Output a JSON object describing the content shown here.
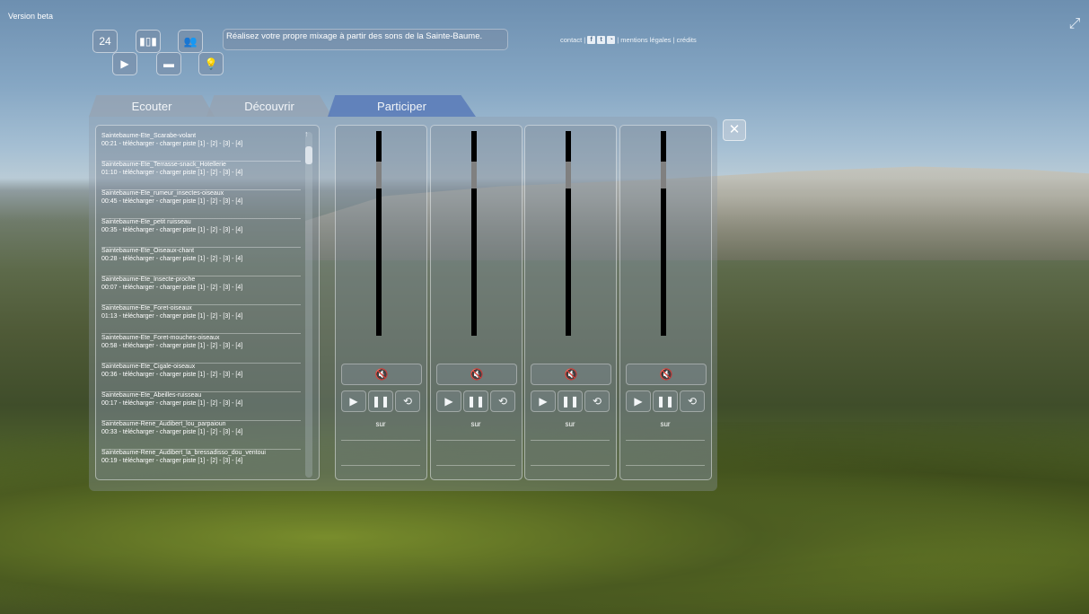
{
  "app": {
    "version_label": "Version beta",
    "banner_text": "Réalisez votre propre mixage à partir des sons de la Sainte-Baume."
  },
  "icons": {
    "calendar": {
      "name": "calendar-icon",
      "glyph": "24"
    },
    "equalizer": {
      "name": "equalizer-icon",
      "glyph": "▮▯▮"
    },
    "users": {
      "name": "users-icon",
      "glyph": "👥"
    },
    "video": {
      "name": "video-icon",
      "glyph": "▶"
    },
    "chat": {
      "name": "chat-icon",
      "glyph": "▬"
    },
    "lightbulb": {
      "name": "lightbulb-icon",
      "glyph": "💡"
    },
    "fullscreen": {
      "name": "fullscreen-icon",
      "glyph": "⤢"
    },
    "close": {
      "name": "close-icon",
      "glyph": "✕"
    },
    "scroll_up": {
      "name": "scroll-up-icon",
      "glyph": "↑"
    }
  },
  "top_links": {
    "contact": "contact |",
    "facebook": "f",
    "twitter": "t",
    "rss": "◔",
    "legal": "| mentions légales | crédits"
  },
  "tabs": [
    {
      "label": "Ecouter",
      "active": false
    },
    {
      "label": "Découvrir",
      "active": false
    },
    {
      "label": "Participer",
      "active": true
    }
  ],
  "sound_list": [
    {
      "title": "Saintebaume-Ete_Scarabe-volant",
      "line": "00:21 - télécharger - charger piste [1] - [2] - [3] - [4]"
    },
    {
      "title": "Saintebaume-Ete_Terrasse-snack_Hotellerie",
      "line": "01:10 - télécharger - charger piste [1] - [2] - [3] - [4]"
    },
    {
      "title": "Saintebaume-Ete_rumeur_insectes-oiseaux",
      "line": "00:45 - télécharger - charger piste [1] - [2] - [3] - [4]"
    },
    {
      "title": "Saintebaume-Ete_petit ruisseau",
      "line": "00:35 - télécharger - charger piste [1] - [2] - [3] - [4]"
    },
    {
      "title": "Saintebaume-Ete_Oiseaux-chant",
      "line": "00:28 - télécharger - charger piste [1] - [2] - [3] - [4]"
    },
    {
      "title": "Saintebaume-Ete_Insecte-proche",
      "line": "00:07 - télécharger - charger piste [1] - [2] - [3] - [4]"
    },
    {
      "title": "Saintebaume-Ete_Foret-oiseaux",
      "line": "01:13 - télécharger - charger piste [1] - [2] - [3] - [4]"
    },
    {
      "title": "Saintebaume-Ete_Foret-mouches-oiseaux",
      "line": "00:58 - télécharger - charger piste [1] - [2] - [3] - [4]"
    },
    {
      "title": "Saintebaume-Ete_Cigale-oiseaux",
      "line": "00:36 - télécharger - charger piste [1] - [2] - [3] - [4]"
    },
    {
      "title": "Saintebaume-Ete_Abeilles-ruisseau",
      "line": "00:17 - télécharger - charger piste [1] - [2] - [3] - [4]"
    },
    {
      "title": "Saintebaume-Rene_Audibert_lou_parpaioun",
      "line": "00:33 - télécharger - charger piste [1] - [2] - [3] - [4]"
    },
    {
      "title": "Saintebaume-Rene_Audibert_la_bressadisso_dou_ventoui",
      "line": "00:19 - télécharger - charger piste [1] - [2] - [3] - [4]"
    }
  ],
  "tracks": [
    {
      "sur_label": "sur",
      "volume": 0.85,
      "mute_icon": "speaker-muted-icon",
      "mute_glyph": "🔇",
      "play_glyph": "▶",
      "pause_glyph": "❚❚",
      "loop_glyph": "⟲"
    },
    {
      "sur_label": "sur",
      "volume": 0.85,
      "mute_icon": "speaker-muted-icon",
      "mute_glyph": "🔇",
      "play_glyph": "▶",
      "pause_glyph": "❚❚",
      "loop_glyph": "⟲"
    },
    {
      "sur_label": "sur",
      "volume": 0.85,
      "mute_icon": "speaker-muted-icon",
      "mute_glyph": "🔇",
      "play_glyph": "▶",
      "pause_glyph": "❚❚",
      "loop_glyph": "⟲"
    },
    {
      "sur_label": "sur",
      "volume": 0.85,
      "mute_icon": "speaker-muted-icon",
      "mute_glyph": "🔇",
      "play_glyph": "▶",
      "pause_glyph": "❚❚",
      "loop_glyph": "⟲"
    }
  ]
}
